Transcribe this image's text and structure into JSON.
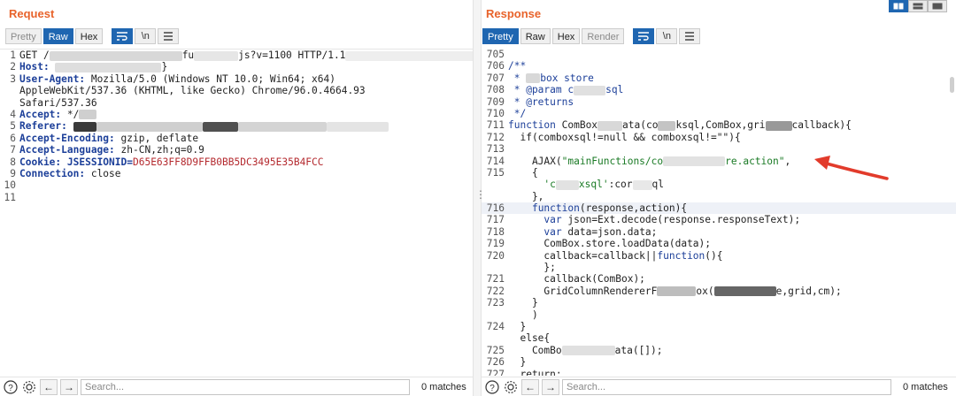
{
  "request": {
    "title": "Request",
    "toolbar": {
      "pretty": "Pretty",
      "raw": "Raw",
      "hex": "Hex",
      "newline": "\\n"
    },
    "lines": [
      {
        "n": "1",
        "parts": [
          {
            "t": "GET /",
            "c": "hdr-val"
          },
          {
            "blur": 150,
            "col": "#d8d8d8"
          },
          {
            "t": "fu",
            "c": "hdr-val"
          },
          {
            "blur": 50,
            "col": "#e6e6e6"
          },
          {
            "t": "js?v=1100 HTTP/1.1",
            "c": "hdr-val"
          },
          {
            "blur": 160,
            "col": "#eeeeee"
          }
        ]
      },
      {
        "n": "2",
        "parts": [
          {
            "t": "Host:",
            "c": "hdr-name"
          },
          {
            "t": " ",
            "c": "hdr-val"
          },
          {
            "blur": 120,
            "col": "#dedede"
          },
          {
            "t": "}",
            "c": "hdr-val"
          }
        ]
      },
      {
        "n": "3",
        "parts": [
          {
            "t": "User-Agent:",
            "c": "hdr-name"
          },
          {
            "t": " Mozilla/5.0 (Windows NT 10.0; Win64; x64)",
            "c": "hdr-val"
          }
        ]
      },
      {
        "n": "",
        "parts": [
          {
            "t": "AppleWebKit/537.36 (KHTML, like Gecko) Chrome/96.0.4664.93",
            "c": "hdr-val"
          }
        ]
      },
      {
        "n": "",
        "parts": [
          {
            "t": "Safari/537.36",
            "c": "hdr-val"
          }
        ]
      },
      {
        "n": "4",
        "parts": [
          {
            "t": "Accept:",
            "c": "hdr-name"
          },
          {
            "t": " */",
            "c": "hdr-val"
          },
          {
            "blur": 20,
            "col": "#cfcfcf"
          }
        ]
      },
      {
        "n": "5",
        "parts": [
          {
            "t": "Referer:",
            "c": "hdr-name"
          },
          {
            "t": " ",
            "c": "hdr-val"
          },
          {
            "blur": 26,
            "col": "#3a3a3a"
          },
          {
            "blur": 120,
            "col": "#cfcfcf"
          },
          {
            "blur": 40,
            "col": "#505050"
          },
          {
            "blur": 100,
            "col": "#d4d4d4"
          },
          {
            "blur": 70,
            "col": "#e4e4e4"
          }
        ]
      },
      {
        "n": "6",
        "parts": [
          {
            "t": "Accept-Encoding:",
            "c": "hdr-name"
          },
          {
            "t": " gzip, deflate",
            "c": "hdr-val"
          }
        ]
      },
      {
        "n": "7",
        "parts": [
          {
            "t": "Accept-Language:",
            "c": "hdr-name"
          },
          {
            "t": " zh-CN,zh;q=0.9",
            "c": "hdr-val"
          }
        ]
      },
      {
        "n": "8",
        "parts": [
          {
            "t": "Cookie:",
            "c": "hdr-name"
          },
          {
            "t": " JSESSIONID=",
            "c": "hdr-name"
          },
          {
            "t": "D65E63FF8D9FFB0BB5DC3495E35B4FCC",
            "c": "cookie-val"
          }
        ]
      },
      {
        "n": "9",
        "parts": [
          {
            "t": "Connection:",
            "c": "hdr-name"
          },
          {
            "t": " close",
            "c": "hdr-val"
          }
        ]
      },
      {
        "n": "10",
        "parts": []
      },
      {
        "n": "11",
        "parts": []
      }
    ],
    "search": {
      "placeholder": "Search...",
      "matches": "0 matches"
    }
  },
  "response": {
    "title": "Response",
    "toolbar": {
      "pretty": "Pretty",
      "raw": "Raw",
      "hex": "Hex",
      "render": "Render",
      "newline": "\\n"
    },
    "lines": [
      {
        "n": "705",
        "parts": []
      },
      {
        "n": "706",
        "parts": [
          {
            "t": "/**",
            "c": "cmt"
          }
        ]
      },
      {
        "n": "707",
        "parts": [
          {
            "t": " * ",
            "c": "cmt"
          },
          {
            "blur": 16,
            "col": "#d8d8d8"
          },
          {
            "t": "box store",
            "c": "cmt"
          }
        ]
      },
      {
        "n": "708",
        "parts": [
          {
            "t": " * @param c",
            "c": "cmt"
          },
          {
            "blur": 36,
            "col": "#e0e0e0"
          },
          {
            "t": "sql",
            "c": "cmt"
          }
        ]
      },
      {
        "n": "709",
        "parts": [
          {
            "t": " * @returns",
            "c": "cmt"
          }
        ]
      },
      {
        "n": "710",
        "parts": [
          {
            "t": " */",
            "c": "cmt"
          }
        ]
      },
      {
        "n": "711",
        "parts": [
          {
            "t": "function",
            "c": "kw"
          },
          {
            "t": " ComBox",
            "c": "hdr-val"
          },
          {
            "blur": 28,
            "col": "#d8d8d8"
          },
          {
            "t": "ata(co",
            "c": "hdr-val"
          },
          {
            "blur": 20,
            "col": "#c4c4c4"
          },
          {
            "t": "ksql,ComBox,gri",
            "c": "hdr-val"
          },
          {
            "blur": 30,
            "col": "#999"
          },
          {
            "t": "callback){",
            "c": "hdr-val"
          }
        ]
      },
      {
        "n": "712",
        "parts": [
          {
            "t": "  if(comboxsql!=null && comboxsql!=\"\"){",
            "c": "hdr-val"
          }
        ]
      },
      {
        "n": "713",
        "parts": []
      },
      {
        "n": "714",
        "parts": [
          {
            "t": "    AJAX(",
            "c": "hdr-val"
          },
          {
            "t": "\"mainFunctions/co",
            "c": "str"
          },
          {
            "blur": 70,
            "col": "#e2e2e2"
          },
          {
            "t": "re.action\"",
            "c": "str"
          },
          {
            "t": ",",
            "c": "hdr-val"
          }
        ]
      },
      {
        "n": "715",
        "parts": [
          {
            "t": "    {",
            "c": "hdr-val"
          }
        ]
      },
      {
        "n": "",
        "parts": [
          {
            "t": "      'c",
            "c": "str"
          },
          {
            "blur": 26,
            "col": "#e2e2e2"
          },
          {
            "t": "xsql'",
            "c": "str"
          },
          {
            "t": ":cor",
            "c": "hdr-val"
          },
          {
            "blur": 22,
            "col": "#e8e8e8"
          },
          {
            "t": "ql",
            "c": "hdr-val"
          }
        ]
      },
      {
        "n": "",
        "parts": [
          {
            "t": "    },",
            "c": "hdr-val"
          }
        ]
      },
      {
        "n": "716",
        "hl": true,
        "parts": [
          {
            "t": "    ",
            "c": "hdr-val"
          },
          {
            "t": "function",
            "c": "kw"
          },
          {
            "t": "(response,action){",
            "c": "hdr-val"
          }
        ]
      },
      {
        "n": "717",
        "parts": [
          {
            "t": "      ",
            "c": "hdr-val"
          },
          {
            "t": "var",
            "c": "kw"
          },
          {
            "t": " json=Ext.decode(response.responseText);",
            "c": "hdr-val"
          }
        ]
      },
      {
        "n": "718",
        "parts": [
          {
            "t": "      ",
            "c": "hdr-val"
          },
          {
            "t": "var",
            "c": "kw"
          },
          {
            "t": " data=json.data;",
            "c": "hdr-val"
          }
        ]
      },
      {
        "n": "719",
        "parts": [
          {
            "t": "      ComBox.store.loadData(data);",
            "c": "hdr-val"
          }
        ]
      },
      {
        "n": "720",
        "parts": [
          {
            "t": "      callback=callback||",
            "c": "hdr-val"
          },
          {
            "t": "function",
            "c": "kw"
          },
          {
            "t": "(){",
            "c": "hdr-val"
          }
        ]
      },
      {
        "n": "",
        "parts": [
          {
            "t": "      };",
            "c": "hdr-val"
          }
        ]
      },
      {
        "n": "721",
        "parts": [
          {
            "t": "      callback(ComBox);",
            "c": "hdr-val"
          }
        ]
      },
      {
        "n": "722",
        "parts": [
          {
            "t": "      GridColumnRendererF",
            "c": "hdr-val"
          },
          {
            "blur": 44,
            "col": "#bdbdbd"
          },
          {
            "t": "ox(",
            "c": "hdr-val"
          },
          {
            "blur": 70,
            "col": "#666"
          },
          {
            "t": "e,grid,cm);",
            "c": "hdr-val"
          }
        ]
      },
      {
        "n": "723",
        "parts": [
          {
            "t": "    }",
            "c": "hdr-val"
          }
        ]
      },
      {
        "n": "",
        "parts": [
          {
            "t": "    )",
            "c": "hdr-val"
          }
        ]
      },
      {
        "n": "724",
        "parts": [
          {
            "t": "  }",
            "c": "hdr-val"
          }
        ]
      },
      {
        "n": "",
        "parts": [
          {
            "t": "  else{",
            "c": "hdr-val"
          }
        ]
      },
      {
        "n": "725",
        "parts": [
          {
            "t": "    ComBo",
            "c": "hdr-val"
          },
          {
            "blur": 60,
            "col": "#e0e0e0"
          },
          {
            "t": "ata([]);",
            "c": "hdr-val"
          }
        ]
      },
      {
        "n": "726",
        "parts": [
          {
            "t": "  }",
            "c": "hdr-val"
          }
        ]
      },
      {
        "n": "727",
        "parts": [
          {
            "t": "  return;",
            "c": "hdr-val"
          }
        ]
      }
    ],
    "search": {
      "placeholder": "Search...",
      "matches": "0 matches"
    }
  },
  "colors": {
    "accent_orange": "#e8632b",
    "active_blue": "#1f66b1",
    "arrow_red": "#e23b2b"
  },
  "icons": [
    "help-icon",
    "settings-icon",
    "arrow-left-icon",
    "arrow-right-icon",
    "wrap-icon",
    "menu-icon"
  ]
}
